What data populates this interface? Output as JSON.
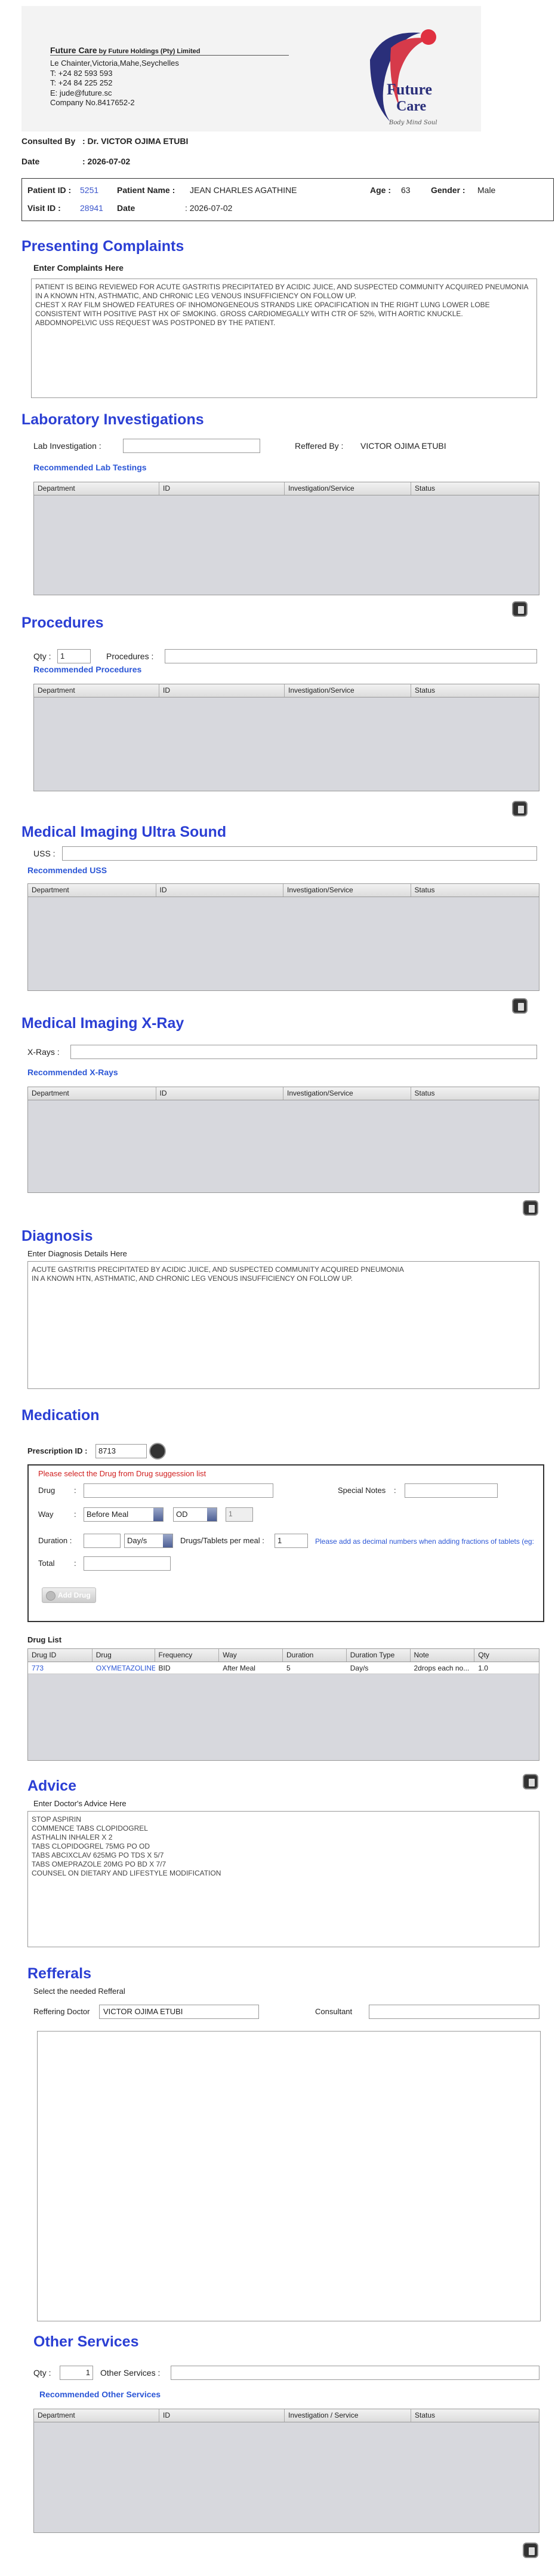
{
  "header": {
    "company_name": "Future Care",
    "company_by": " by Future Holdings (Pty) Limited",
    "address": [
      "Le Chainter,Victoria,Mahe,Seychelles",
      "T: +24  82 593 593",
      "T: +24  84 225 252",
      "E: jude@future.sc",
      "Company No.8417652-2"
    ],
    "logo_text": "Future",
    "logo_text2": "Care",
    "logo_tagline": "Body Mind Soul"
  },
  "consult": {
    "consulted_label": "Consulted By",
    "consulted_value": ":  Dr.   VICTOR OJIMA ETUBI",
    "date_label": "Date",
    "date_value": ":   2026-07-02"
  },
  "patient": {
    "id_label": "Patient ID",
    "id_value": "5251",
    "name_label": "Patient Name",
    "name_value": "JEAN CHARLES AGATHINE",
    "age_label": "Age",
    "age_value": "63",
    "gender_label": "Gender",
    "gender_value": "Male",
    "visit_label": "Visit ID",
    "visit_value": "28941",
    "date_label": "Date",
    "date_value": "2026-07-02"
  },
  "complaints": {
    "title": "Presenting Complaints",
    "subtitle": "Enter Complaints Here",
    "text": "Patient is being reviewed for acute gastritis precipitated by acidic juice, and suspected community acquired pneumonia in a known HTN, asthmatic, and chronic leg venous insufficiency on follow up.\nChest X ray film showed features of inhomongeneous strands like opacification in the right lung lower lobe consistent with positive past hx of smoking. Gross cardiomegally with CTR of 52%, with aortic knuckle.\nAbdomnopelvic USS request was postponed by the patient."
  },
  "lab": {
    "title": "Laboratory  Investigations",
    "field_label": "Lab Investigation :",
    "referred_label": "Reffered By :",
    "referred_value": "VICTOR OJIMA ETUBI",
    "recommended": "Recommended Lab Testings",
    "columns": [
      "Department",
      "ID",
      "Investigation/Service",
      "Status"
    ]
  },
  "procedures": {
    "title": "Procedures",
    "qty_label": "Qty :",
    "qty_value": "1",
    "field_label": "Procedures :",
    "recommended": "Recommended Procedures",
    "columns": [
      "Department",
      "ID",
      "Investigation/Service",
      "Status"
    ]
  },
  "uss": {
    "title": "Medical Imaging Ultra Sound",
    "field_label": "USS :",
    "recommended": "Recommended USS",
    "columns": [
      "Department",
      "ID",
      "Investigation/Service",
      "Status"
    ]
  },
  "xray": {
    "title": "Medical Imaging X-Ray",
    "field_label": "X-Rays :",
    "recommended": "Recommended X-Rays",
    "columns": [
      "Department",
      "ID",
      "Investigation/Service",
      "Status"
    ]
  },
  "diagnosis": {
    "title": "Diagnosis",
    "subtitle": "Enter Diagnosis Details Here",
    "text": "Acute gastritis precipitated by acidic juice, and suspected community acquired pneumonia\nin a known HTN, asthmatic, and chronic leg venous insufficiency on follow up."
  },
  "medication": {
    "title": "Medication",
    "rx_label": "Prescription ID :",
    "rx_value": "8713",
    "warning": "Please select the Drug from Drug suggession list",
    "drug_label": "Drug",
    "special_label": "Special Notes",
    "way_label": "Way",
    "way_value": "Before Meal",
    "freq_value": "OD",
    "freq_count": "1",
    "duration_label": "Duration :",
    "duration_unit": "Day/s",
    "per_meal_label": "Drugs/Tablets per meal :",
    "per_meal_value": "1",
    "hint": "Please add as decimal numbers when adding fractions of tablets (eg:",
    "total_label": "Total",
    "add_button": "Add Drug",
    "colon": ":"
  },
  "druglist": {
    "title": "Drug List",
    "columns": [
      "Drug ID",
      "Drug",
      "Frequency",
      "Way",
      "Duration",
      "Duration Type",
      "Note",
      "Qty"
    ],
    "rows": [
      [
        "773",
        "OXYMETAZOLINE",
        "BID",
        "After Meal",
        "5",
        "Day/s",
        "2drops each no...",
        "1.0"
      ]
    ]
  },
  "advice": {
    "title": "Advice",
    "subtitle": "Enter Doctor's Advice Here",
    "text": "Stop aspirin\nCommence tabs clopidogrel\nasthalin inhaler x 2\nTabs Clopidogrel 75mg PO OD\nTabs Abcixclav 625mg po tds x 5/7\nTabs Omeprazole 20mg PO BD X 7/7\nCounsel on dietary and lifestyle modification"
  },
  "referrals": {
    "title": "Refferals",
    "subtitle": "Select the needed Refferal",
    "doctor_label": "Reffering Doctor",
    "doctor_value": "VICTOR OJIMA ETUBI",
    "consultant_label": "Consultant"
  },
  "other": {
    "title": "Other Services",
    "qty_label": "Qty :",
    "qty_value": "1",
    "field_label": "Other Services :",
    "recommended": "Recommended Other Services",
    "columns": [
      "Department",
      "ID",
      "Investigation / Service",
      "Status"
    ]
  }
}
